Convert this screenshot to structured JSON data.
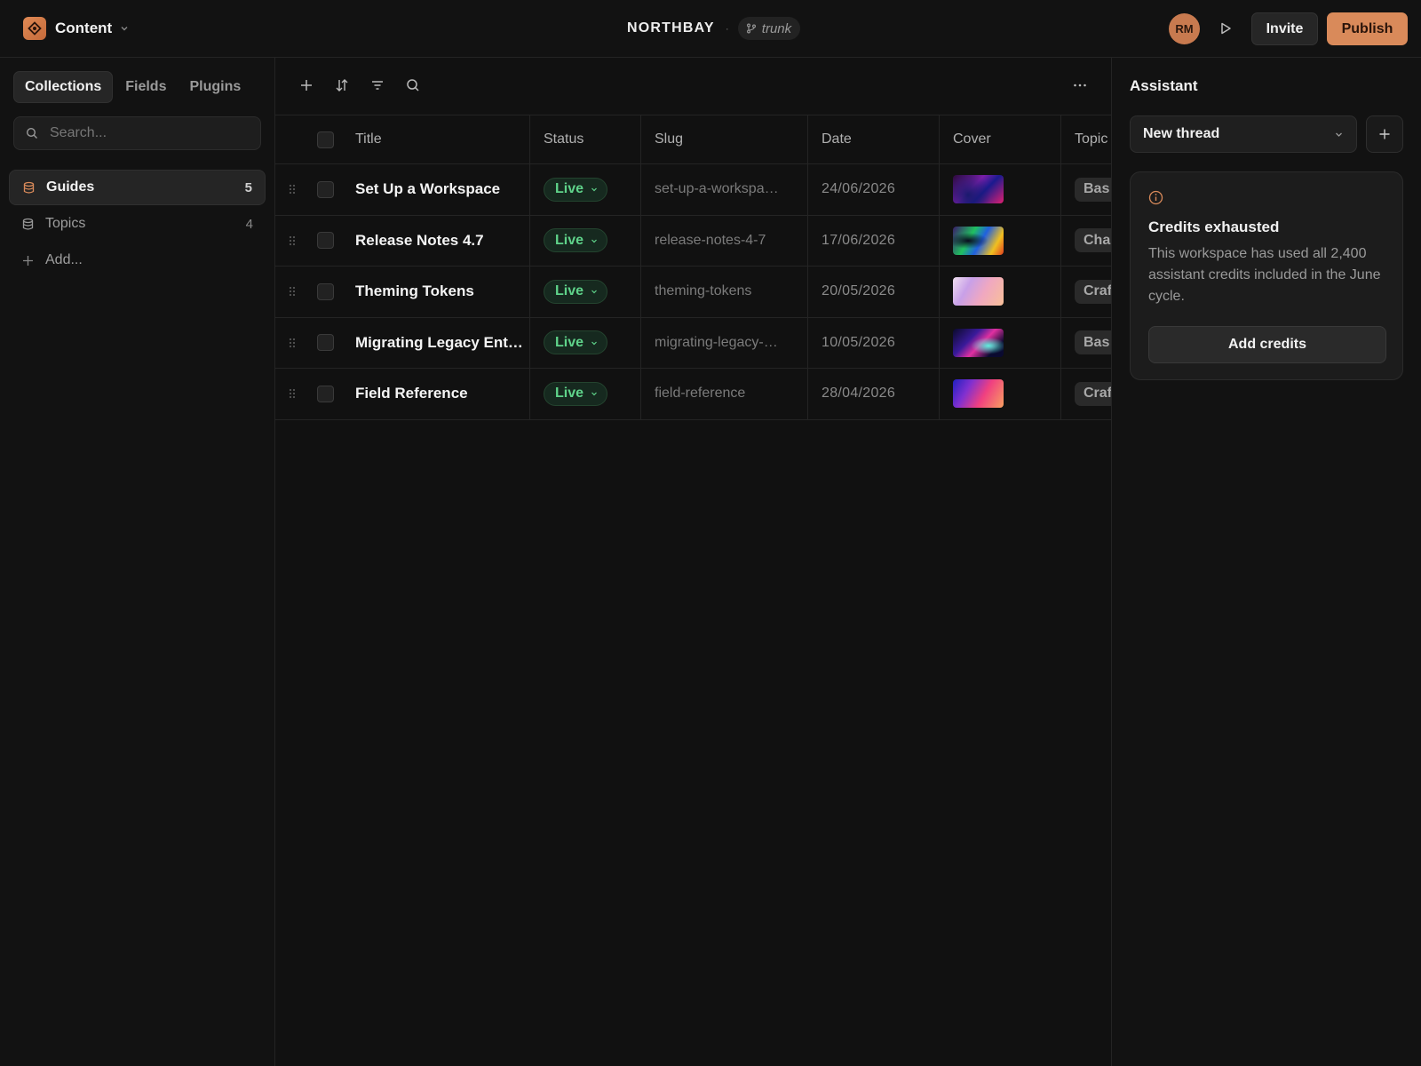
{
  "header": {
    "app_name": "Content",
    "project_name": "NORTHBAY",
    "separator": "·",
    "branch": "trunk",
    "avatar_initials": "RM",
    "invite_label": "Invite",
    "publish_label": "Publish"
  },
  "sidebar": {
    "tabs": [
      {
        "label": "Collections"
      },
      {
        "label": "Fields"
      },
      {
        "label": "Plugins"
      }
    ],
    "search_placeholder": "Search...",
    "collections": [
      {
        "label": "Guides",
        "count": "5"
      },
      {
        "label": "Topics",
        "count": "4"
      }
    ],
    "add_label": "Add..."
  },
  "table": {
    "columns": [
      "Title",
      "Status",
      "Slug",
      "Date",
      "Cover",
      "Topic"
    ],
    "rows": [
      {
        "title": "Set Up a Workspace",
        "status": "Live",
        "slug": "set-up-a-workspa…",
        "date": "24/06/2026",
        "topic": "Bas"
      },
      {
        "title": "Release Notes 4.7",
        "status": "Live",
        "slug": "release-notes-4-7",
        "date": "17/06/2026",
        "topic": "Cha"
      },
      {
        "title": "Theming Tokens",
        "status": "Live",
        "slug": "theming-tokens",
        "date": "20/05/2026",
        "topic": "Craf"
      },
      {
        "title": "Migrating Legacy Ent…",
        "status": "Live",
        "slug": "migrating-legacy-…",
        "date": "10/05/2026",
        "topic": "Bas"
      },
      {
        "title": "Field Reference",
        "status": "Live",
        "slug": "field-reference",
        "date": "28/04/2026",
        "topic": "Craf"
      }
    ]
  },
  "assistant": {
    "title": "Assistant",
    "thread_select": "New thread",
    "credit_title": "Credits exhausted",
    "credit_body": "This workspace has used all 2,400 assistant credits included in the June cycle.",
    "add_credits_label": "Add credits"
  },
  "colors": {
    "accent": "#d98a5a",
    "status_live": "#5fd38a",
    "background": "#111111"
  }
}
